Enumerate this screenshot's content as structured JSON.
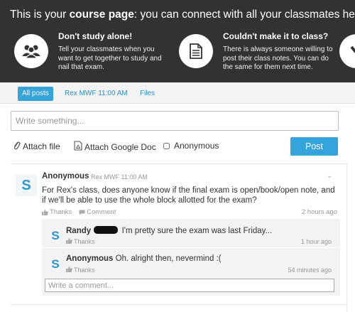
{
  "banner": {
    "title_prefix": "This is your ",
    "title_bold": "course page",
    "title_suffix": ": you can connect with all your classmates here.",
    "features": [
      {
        "title": "Don't study alone!",
        "desc": "Tell your classmates when you want to get together to study and nail that exam.",
        "icon": "people-icon"
      },
      {
        "title": "Couldn't make it to class?",
        "desc": "There is always someone willing to post their class notes. You can do the same for them next time.",
        "icon": "document-icon"
      }
    ]
  },
  "tabs": [
    {
      "label": "All posts",
      "active": true
    },
    {
      "label": "Rex MWF 11:00 AM",
      "active": false
    },
    {
      "label": "Files",
      "active": false
    }
  ],
  "compose": {
    "placeholder": "Write something...",
    "attach_file": "Attach file",
    "attach_doc": "Attach Google Doc",
    "anonymous": "Anonymous",
    "post": "Post"
  },
  "post": {
    "avatar": "S",
    "author": "Anonymous",
    "section": "Rex MWF 11:00 AM",
    "body": "For Rex's class, does anyone know if the final exam is open/book/open note, and if we'll be able to use the whole block allotted for the exam?",
    "thanks": "Thanks",
    "comment": "Comment",
    "time": "2 hours ago",
    "replies": [
      {
        "avatar": "S",
        "author": "Randy",
        "text": "I'm pretty sure the exam was last Friday...",
        "thanks": "Thanks",
        "time": "1 hour ago"
      },
      {
        "avatar": "S",
        "author": "Anonymous",
        "text": "Oh. alright then, nevermind :(",
        "thanks": "Thanks",
        "time": "54 minutes ago"
      }
    ],
    "comment_placeholder": "Write a comment..."
  },
  "colors": {
    "accent": "#35a4dc",
    "banner_bg": "#323232"
  }
}
